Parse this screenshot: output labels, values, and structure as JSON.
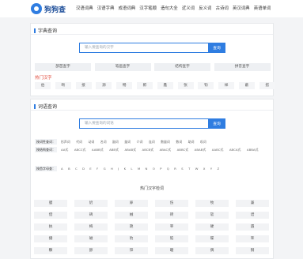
{
  "site": {
    "logo_text": "狗狗查"
  },
  "nav": [
    "汉语词典",
    "汉语字典",
    "成语词典",
    "汉字笔顺",
    "造句大全",
    "近义词",
    "反义词",
    "古诗词",
    "英汉词典",
    "英语单词"
  ],
  "zidian": {
    "title": "字典查询",
    "placeholder": "输入要查询的汉字",
    "button": "查询",
    "tabs": [
      "部首查字",
      "笔画查字",
      "结构查字",
      "拼音查字"
    ],
    "hot_title": "热门汉字",
    "hot_chars": [
      "伯",
      "吻",
      "接",
      "源",
      "畅",
      "孵",
      "鑫",
      "张",
      "钩",
      "样",
      "蔽",
      "搭"
    ]
  },
  "cidian": {
    "title": "词语查询",
    "placeholder": "输入要查询的词语",
    "button": "查询",
    "by_pos_label": "按词性查词：",
    "by_pos": [
      "形声词",
      "代词",
      "动词",
      "名词",
      "副词",
      "量词",
      "介词",
      "连词",
      "数量词",
      "数词",
      "助词",
      "叹词"
    ],
    "by_struct_label": "按结构查词：",
    "by_struct": [
      "AA式",
      "ABCC式",
      "AABB式",
      "ABB式",
      "ABAB式",
      "ABCB式",
      "ABAC式",
      "ABBC式",
      "ABAB式",
      "AABC式",
      "ABCA式",
      "ABBA式"
    ],
    "by_letter_label": "按首字母查：",
    "letters": [
      "A",
      "B",
      "C",
      "D",
      "E",
      "F",
      "G",
      "H",
      "J",
      "K",
      "L",
      "M",
      "N",
      "O",
      "P",
      "Q",
      "R",
      "S",
      "T",
      "W",
      "X",
      "Y",
      "Z"
    ],
    "hot_title": "热门汉字检词",
    "hot_grid": [
      [
        "膜",
        "奶",
        "扉",
        "伤",
        "牧",
        "兼"
      ],
      [
        "借",
        "碑",
        "械",
        "砖",
        "软",
        "谱"
      ],
      [
        "执",
        "梅",
        "艳",
        "宰",
        "硬",
        "遇"
      ],
      [
        "播",
        "磁",
        "豹",
        "陷",
        "碟",
        "笨"
      ],
      [
        "糠",
        "醇",
        "锌",
        "暧",
        "偶",
        "钢"
      ]
    ]
  }
}
